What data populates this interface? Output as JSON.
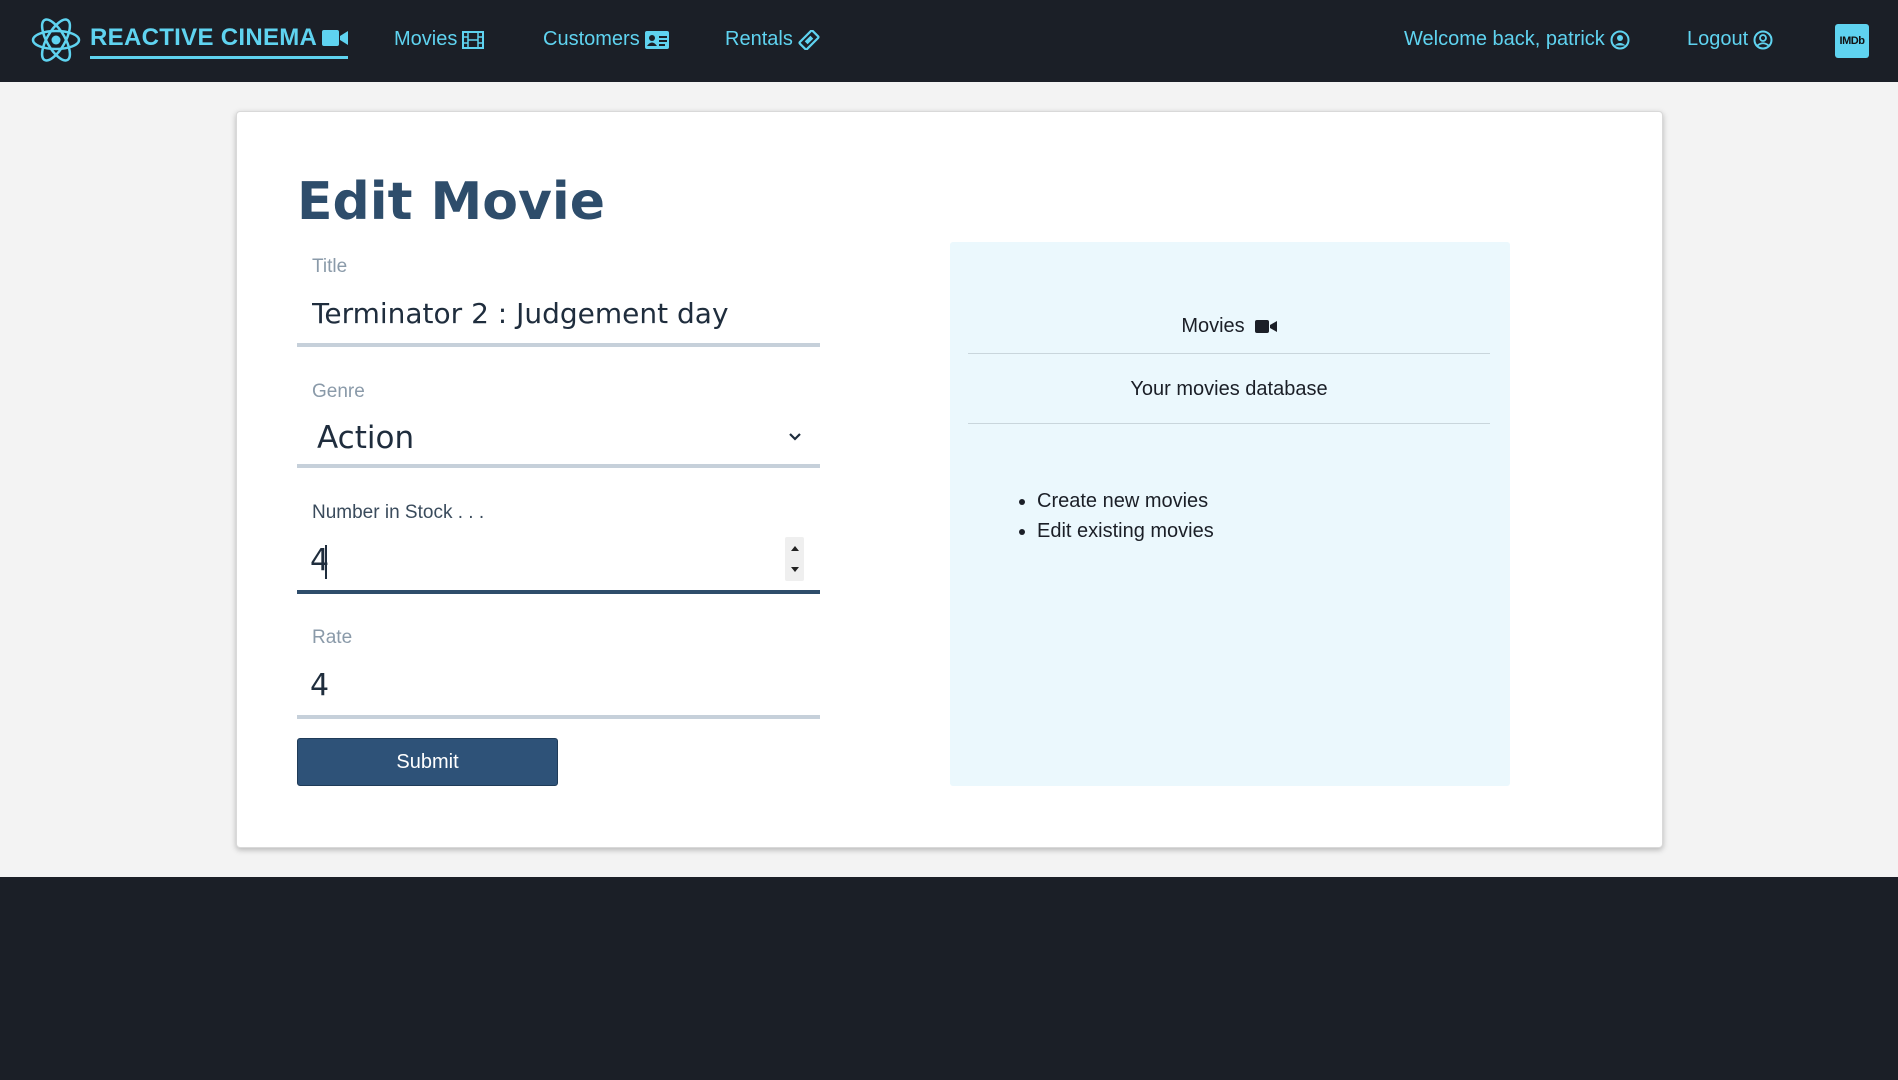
{
  "nav": {
    "brand": "REACTIVE CINEMA",
    "movies": "Movies",
    "customers": "Customers",
    "rentals": "Rentals",
    "welcome": "Welcome back, patrick",
    "logout": "Logout",
    "imdb": "IMDb"
  },
  "form": {
    "title": "Edit Movie",
    "title_label": "Title",
    "title_value": "Terminator 2 : Judgement day",
    "genre_label": "Genre",
    "genre_value": "Action",
    "stock_label": "Number in Stock . . .",
    "stock_value": "4",
    "rate_label": "Rate",
    "rate_value": "4",
    "submit": "Submit"
  },
  "info": {
    "header": "Movies",
    "subtitle": "Your movies database",
    "items": [
      "Create new movies",
      "Edit existing movies"
    ]
  },
  "colors": {
    "accent": "#5fd3f0",
    "nav_bg": "#1b1f27",
    "primary": "#2e5278",
    "panel_bg": "#ebf8fd"
  }
}
